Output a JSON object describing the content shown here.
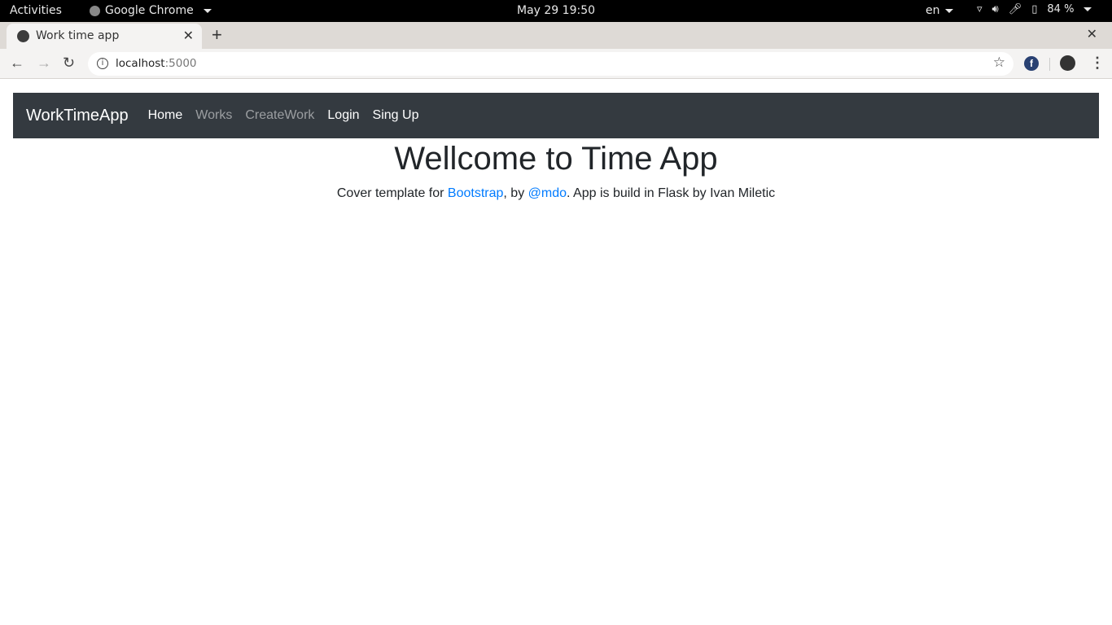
{
  "system_bar": {
    "activities": "Activities",
    "app_name": "Google Chrome",
    "clock": "May 29  19:50",
    "language": "en",
    "battery": "84 %"
  },
  "browser": {
    "tab_title": "Work time app",
    "url_host": "localhost",
    "url_port": ":5000"
  },
  "navbar": {
    "brand": "WorkTimeApp",
    "links": [
      {
        "label": "Home",
        "active": true
      },
      {
        "label": "Works",
        "active": false
      },
      {
        "label": "CreateWork",
        "active": false
      },
      {
        "label": "Login",
        "active": true
      },
      {
        "label": "Sing Up",
        "active": true
      }
    ]
  },
  "main": {
    "title": "Wellcome to Time App",
    "lead_prefix": "Cover template for ",
    "lead_link1": "Bootstrap",
    "lead_mid": ", by ",
    "lead_link2": "@mdo",
    "lead_suffix": ". App is build in Flask by Ivan Miletic"
  },
  "colors": {
    "navbar_bg": "#343a40",
    "link": "#007bff"
  }
}
